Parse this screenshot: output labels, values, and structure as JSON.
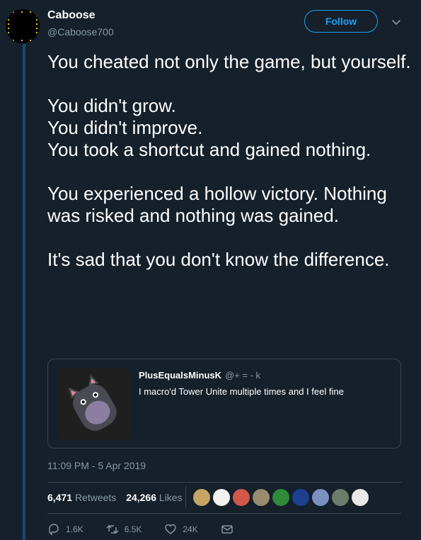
{
  "author": {
    "name": "Caboose",
    "handle": "@Caboose700"
  },
  "follow_label": "Follow",
  "tweet_paragraphs": [
    "You cheated not only the game, but yourself.",
    "You didn't grow.\nYou didn't improve.\nYou took a shortcut and gained nothing.",
    "You experienced a hollow victory. Nothing was risked and nothing was gained.",
    "It's sad that you don't know the difference."
  ],
  "quote": {
    "name": "PlusEqualsMinusK",
    "handle": "@+ = - k",
    "text": "I macro'd Tower Unite multiple times and I feel fine"
  },
  "timestamp": "11:09 PM - 5 Apr 2019",
  "stats": {
    "retweets_count": "6,471",
    "retweets_label": "Retweets",
    "likes_count": "24,266",
    "likes_label": "Likes"
  },
  "likers": [
    "#c8a464",
    "#f2f2f2",
    "#d1574a",
    "#9b8b6e",
    "#2f8a3c",
    "#1f3f8f",
    "#7a90c0",
    "#6b7d6a",
    "#e8e8e8"
  ],
  "actions": {
    "replies": "1.6K",
    "retweets": "6.5K",
    "likes": "24K"
  },
  "colors": {
    "background": "#15202b",
    "accent": "#1da1f2",
    "muted": "#8899a6"
  }
}
